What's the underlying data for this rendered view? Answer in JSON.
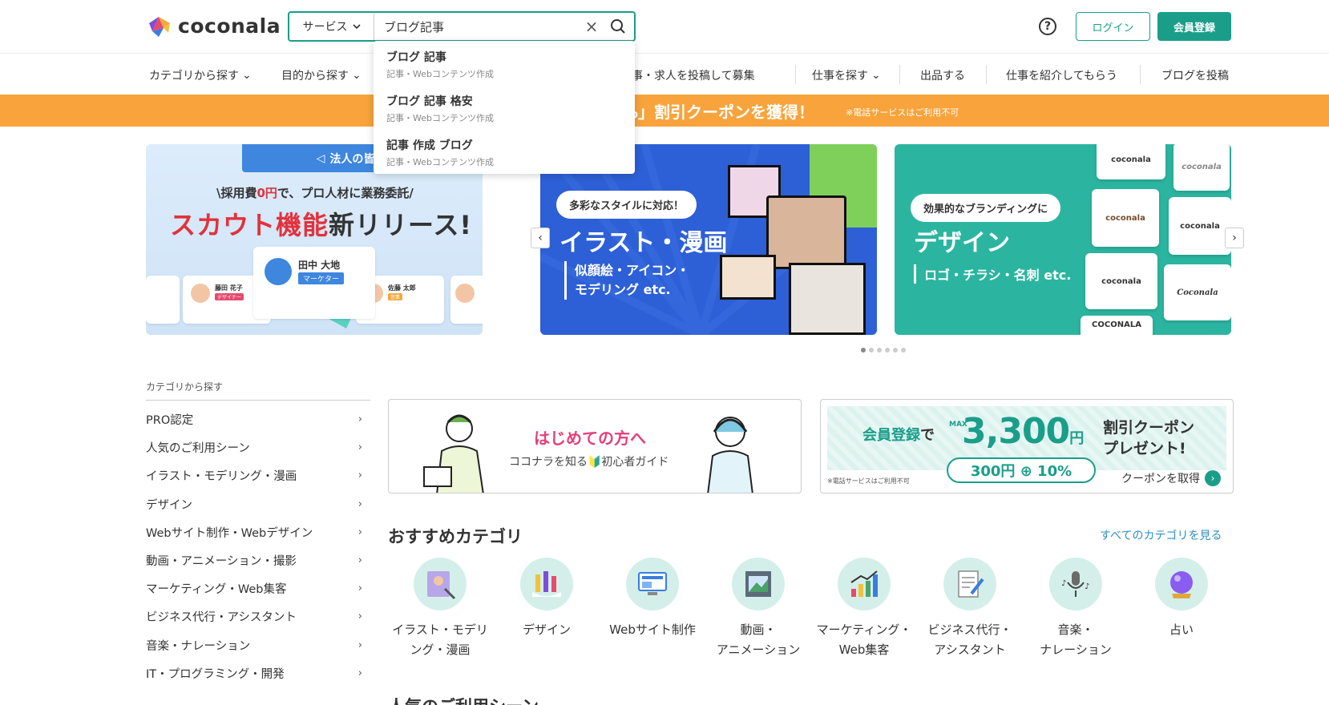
{
  "header": {
    "logo_text": "coconala",
    "search_category": "サービス",
    "search_value": "ブログ記事",
    "login_label": "ログイン",
    "signup_label": "会員登録"
  },
  "nav": {
    "items": [
      {
        "label": "カテゴリから探す",
        "dropdown": true
      },
      {
        "label": "目的から探す",
        "dropdown": true
      },
      {
        "label": "仕事・求人を投稿して募集",
        "dropdown": false
      },
      {
        "label": "仕事を探す",
        "dropdown": true
      },
      {
        "label": "出品する",
        "dropdown": false
      },
      {
        "label": "仕事を紹介してもらう",
        "dropdown": false
      },
      {
        "label": "ブログを投稿",
        "dropdown": false
      }
    ]
  },
  "promo": {
    "main": "%」割引クーポンを獲得！",
    "note": "※電話サービスはご利用不可"
  },
  "suggestions": [
    {
      "title": "ブログ 記事",
      "sub": "記事・Webコンテンツ作成"
    },
    {
      "title": "ブログ 記事 格安",
      "sub": "記事・Webコンテンツ作成"
    },
    {
      "title": "記事 作成 ブログ",
      "sub": "記事・Webコンテンツ作成"
    }
  ],
  "slides": {
    "s1": {
      "tab": "法人の皆さまへ",
      "sub_pre": "\\採用費",
      "sub_zero": "0円",
      "sub_post": "で、プロ人材に業務委託/",
      "title_red": "スカウト機能",
      "title_black": "新リリース!",
      "card_name": "田中 大地",
      "card_role": "マーケター",
      "left_name": "藤田 花子",
      "left_role": "デザイナー",
      "right_name": "佐藤 太郎",
      "right_role": "営業"
    },
    "s2": {
      "pill": "多彩なスタイルに対応！",
      "title": "イラスト・漫画",
      "sub1": "似顔絵・アイコン・",
      "sub2": "モデリング etc."
    },
    "s3": {
      "pill": "効果的なブランディングに",
      "title": "デザイン",
      "sub": "ロゴ・チラシ・名刺 etc.",
      "tile1": "coconala",
      "tile2": "coconala",
      "tile3": "coconala",
      "tile4": "coconala",
      "tile5": "coconala",
      "tile6": "Coconala",
      "tile7": "COCONALA"
    }
  },
  "sidebar": {
    "heading": "カテゴリから探す",
    "items": [
      "PRO認定",
      "人気のご利用シーン",
      "イラスト・モデリング・漫画",
      "デザイン",
      "Webサイト制作・Webデザイン",
      "動画・アニメーション・撮影",
      "マーケティング・Web集客",
      "ビジネス代行・アシスタント",
      "音楽・ナレーション",
      "IT・プログラミング・開発"
    ]
  },
  "guide": {
    "title": "はじめての方へ",
    "sub": "ココナラを知る🔰初心者ガイド"
  },
  "coupon": {
    "reg": "会員登録",
    "de": "で",
    "max": "MAX",
    "amount": "3,300",
    "yen": "円",
    "right1": "割引クーポン",
    "right2": "プレゼント!",
    "pill": "300円 ⊕ 10%",
    "note": "※電話サービスはご利用不可",
    "link": "クーポンを取得"
  },
  "recommended": {
    "title": "おすすめカテゴリ",
    "link": "すべてのカテゴリを見る",
    "cats": [
      {
        "l1": "イラスト・モデリ",
        "l2": "ング・漫画"
      },
      {
        "l1": "デザイン",
        "l2": ""
      },
      {
        "l1": "Webサイト制作",
        "l2": ""
      },
      {
        "l1": "動画・",
        "l2": "アニメーション"
      },
      {
        "l1": "マーケティング・",
        "l2": "Web集客"
      },
      {
        "l1": "ビジネス代行・",
        "l2": "アシスタント"
      },
      {
        "l1": "音楽・",
        "l2": "ナレーション"
      },
      {
        "l1": "占い",
        "l2": ""
      }
    ]
  },
  "next_section": "人気のご利用シーン"
}
